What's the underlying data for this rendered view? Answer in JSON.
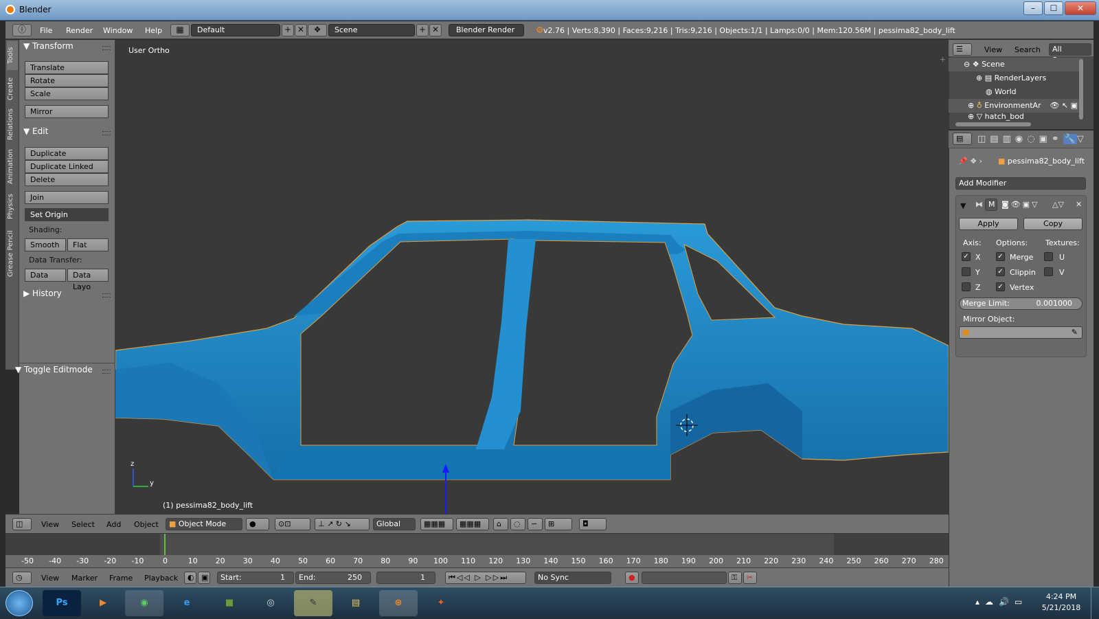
{
  "window": {
    "title": "Blender",
    "minimize": "–",
    "maximize": "☐",
    "close": "✕"
  },
  "info_header": {
    "menus": [
      "File",
      "Render",
      "Window",
      "Help"
    ],
    "screen_layout": "Default",
    "scene": "Scene",
    "render_engine": "Blender Render",
    "stats": "v2.76 | Verts:8,390 | Faces:9,216 | Tris:9,216 | Objects:1/1 | Lamps:0/0 | Mem:120.56M | pessima82_body_lift"
  },
  "tool_tabs": [
    "Tools",
    "Create",
    "Relations",
    "Animation",
    "Physics",
    "Grease Pencil"
  ],
  "tool_shelf": {
    "transform": {
      "header": "Transform",
      "buttons": [
        "Translate",
        "Rotate",
        "Scale",
        "Mirror"
      ]
    },
    "edit": {
      "header": "Edit",
      "buttons": [
        "Duplicate",
        "Duplicate Linked",
        "Delete",
        "Join"
      ],
      "set_origin": "Set Origin"
    },
    "shading": {
      "label": "Shading:",
      "smooth": "Smooth",
      "flat": "Flat"
    },
    "data_transfer": {
      "label": "Data Transfer:",
      "data": "Data",
      "data_layout": "Data Layo"
    },
    "history": {
      "header": "History"
    },
    "operator": {
      "header": "Toggle Editmode"
    }
  },
  "viewport": {
    "view_name": "User Ortho",
    "object_label": "(1) pessima82_body_lift",
    "axis_z": "z",
    "axis_y": "y",
    "mesh_color": "#1e88c8"
  },
  "view3d_header": {
    "menus": [
      "View",
      "Select",
      "Add",
      "Object"
    ],
    "mode": "Object Mode",
    "orientation": "Global"
  },
  "timeline": {
    "ticks": [
      "-50",
      "-40",
      "-30",
      "-20",
      "-10",
      "0",
      "10",
      "20",
      "30",
      "40",
      "50",
      "60",
      "70",
      "80",
      "90",
      "100",
      "110",
      "120",
      "130",
      "140",
      "150",
      "160",
      "170",
      "180",
      "190",
      "200",
      "210",
      "220",
      "230",
      "240",
      "250",
      "260",
      "270",
      "280"
    ],
    "menus": [
      "View",
      "Marker",
      "Frame",
      "Playback"
    ],
    "start_label": "Start:",
    "start": "1",
    "end_label": "End:",
    "end": "250",
    "current_frame": "1",
    "sync": "No Sync"
  },
  "outliner": {
    "header_menus": [
      "View",
      "Search"
    ],
    "filter": "All Scenes",
    "items": [
      "Scene",
      "RenderLayers",
      "World",
      "EnvironmentAr",
      "hatch_bod"
    ]
  },
  "properties": {
    "object_name": "pessima82_body_lift",
    "add_modifier": "Add Modifier",
    "modifier_name": "M",
    "apply": "Apply",
    "copy": "Copy",
    "axis_label": "Axis:",
    "options_label": "Options:",
    "textures_label": "Textures:",
    "axis": [
      {
        "label": "X",
        "checked": true
      },
      {
        "label": "Y",
        "checked": false
      },
      {
        "label": "Z",
        "checked": false
      }
    ],
    "options": [
      {
        "label": "Merge",
        "checked": true
      },
      {
        "label": "Clippin",
        "checked": true
      },
      {
        "label": "Vertex",
        "checked": true
      }
    ],
    "textures": [
      {
        "label": "U",
        "checked": false
      },
      {
        "label": "V",
        "checked": false
      }
    ],
    "merge_limit_label": "Merge Limit:",
    "merge_limit": "0.001000",
    "mirror_object_label": "Mirror Object:"
  },
  "taskbar": {
    "apps": [
      "Ps",
      "▶",
      "◉",
      "e",
      "■",
      "◎",
      "✎",
      "▤",
      "⊛",
      "✦"
    ],
    "time": "4:24 PM",
    "date": "5/21/2018"
  }
}
